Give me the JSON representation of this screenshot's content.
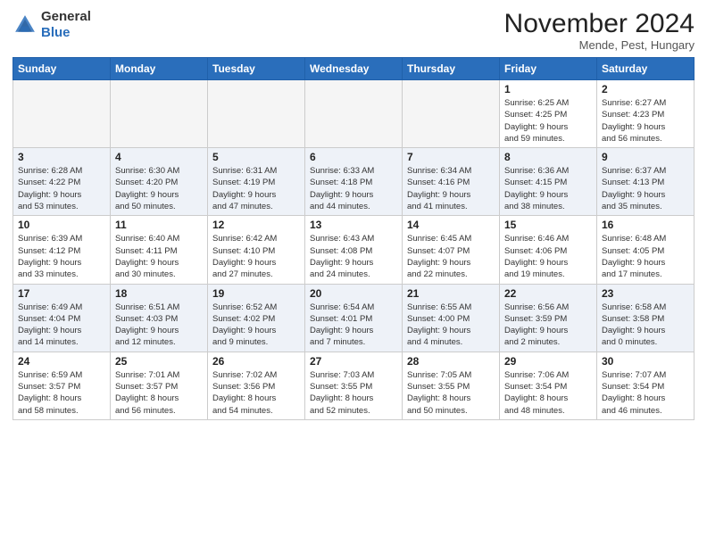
{
  "header": {
    "logo_general": "General",
    "logo_blue": "Blue",
    "month": "November 2024",
    "location": "Mende, Pest, Hungary"
  },
  "weekdays": [
    "Sunday",
    "Monday",
    "Tuesday",
    "Wednesday",
    "Thursday",
    "Friday",
    "Saturday"
  ],
  "weeks": [
    [
      {
        "day": "",
        "info": ""
      },
      {
        "day": "",
        "info": ""
      },
      {
        "day": "",
        "info": ""
      },
      {
        "day": "",
        "info": ""
      },
      {
        "day": "",
        "info": ""
      },
      {
        "day": "1",
        "info": "Sunrise: 6:25 AM\nSunset: 4:25 PM\nDaylight: 9 hours\nand 59 minutes."
      },
      {
        "day": "2",
        "info": "Sunrise: 6:27 AM\nSunset: 4:23 PM\nDaylight: 9 hours\nand 56 minutes."
      }
    ],
    [
      {
        "day": "3",
        "info": "Sunrise: 6:28 AM\nSunset: 4:22 PM\nDaylight: 9 hours\nand 53 minutes."
      },
      {
        "day": "4",
        "info": "Sunrise: 6:30 AM\nSunset: 4:20 PM\nDaylight: 9 hours\nand 50 minutes."
      },
      {
        "day": "5",
        "info": "Sunrise: 6:31 AM\nSunset: 4:19 PM\nDaylight: 9 hours\nand 47 minutes."
      },
      {
        "day": "6",
        "info": "Sunrise: 6:33 AM\nSunset: 4:18 PM\nDaylight: 9 hours\nand 44 minutes."
      },
      {
        "day": "7",
        "info": "Sunrise: 6:34 AM\nSunset: 4:16 PM\nDaylight: 9 hours\nand 41 minutes."
      },
      {
        "day": "8",
        "info": "Sunrise: 6:36 AM\nSunset: 4:15 PM\nDaylight: 9 hours\nand 38 minutes."
      },
      {
        "day": "9",
        "info": "Sunrise: 6:37 AM\nSunset: 4:13 PM\nDaylight: 9 hours\nand 35 minutes."
      }
    ],
    [
      {
        "day": "10",
        "info": "Sunrise: 6:39 AM\nSunset: 4:12 PM\nDaylight: 9 hours\nand 33 minutes."
      },
      {
        "day": "11",
        "info": "Sunrise: 6:40 AM\nSunset: 4:11 PM\nDaylight: 9 hours\nand 30 minutes."
      },
      {
        "day": "12",
        "info": "Sunrise: 6:42 AM\nSunset: 4:10 PM\nDaylight: 9 hours\nand 27 minutes."
      },
      {
        "day": "13",
        "info": "Sunrise: 6:43 AM\nSunset: 4:08 PM\nDaylight: 9 hours\nand 24 minutes."
      },
      {
        "day": "14",
        "info": "Sunrise: 6:45 AM\nSunset: 4:07 PM\nDaylight: 9 hours\nand 22 minutes."
      },
      {
        "day": "15",
        "info": "Sunrise: 6:46 AM\nSunset: 4:06 PM\nDaylight: 9 hours\nand 19 minutes."
      },
      {
        "day": "16",
        "info": "Sunrise: 6:48 AM\nSunset: 4:05 PM\nDaylight: 9 hours\nand 17 minutes."
      }
    ],
    [
      {
        "day": "17",
        "info": "Sunrise: 6:49 AM\nSunset: 4:04 PM\nDaylight: 9 hours\nand 14 minutes."
      },
      {
        "day": "18",
        "info": "Sunrise: 6:51 AM\nSunset: 4:03 PM\nDaylight: 9 hours\nand 12 minutes."
      },
      {
        "day": "19",
        "info": "Sunrise: 6:52 AM\nSunset: 4:02 PM\nDaylight: 9 hours\nand 9 minutes."
      },
      {
        "day": "20",
        "info": "Sunrise: 6:54 AM\nSunset: 4:01 PM\nDaylight: 9 hours\nand 7 minutes."
      },
      {
        "day": "21",
        "info": "Sunrise: 6:55 AM\nSunset: 4:00 PM\nDaylight: 9 hours\nand 4 minutes."
      },
      {
        "day": "22",
        "info": "Sunrise: 6:56 AM\nSunset: 3:59 PM\nDaylight: 9 hours\nand 2 minutes."
      },
      {
        "day": "23",
        "info": "Sunrise: 6:58 AM\nSunset: 3:58 PM\nDaylight: 9 hours\nand 0 minutes."
      }
    ],
    [
      {
        "day": "24",
        "info": "Sunrise: 6:59 AM\nSunset: 3:57 PM\nDaylight: 8 hours\nand 58 minutes."
      },
      {
        "day": "25",
        "info": "Sunrise: 7:01 AM\nSunset: 3:57 PM\nDaylight: 8 hours\nand 56 minutes."
      },
      {
        "day": "26",
        "info": "Sunrise: 7:02 AM\nSunset: 3:56 PM\nDaylight: 8 hours\nand 54 minutes."
      },
      {
        "day": "27",
        "info": "Sunrise: 7:03 AM\nSunset: 3:55 PM\nDaylight: 8 hours\nand 52 minutes."
      },
      {
        "day": "28",
        "info": "Sunrise: 7:05 AM\nSunset: 3:55 PM\nDaylight: 8 hours\nand 50 minutes."
      },
      {
        "day": "29",
        "info": "Sunrise: 7:06 AM\nSunset: 3:54 PM\nDaylight: 8 hours\nand 48 minutes."
      },
      {
        "day": "30",
        "info": "Sunrise: 7:07 AM\nSunset: 3:54 PM\nDaylight: 8 hours\nand 46 minutes."
      }
    ]
  ]
}
